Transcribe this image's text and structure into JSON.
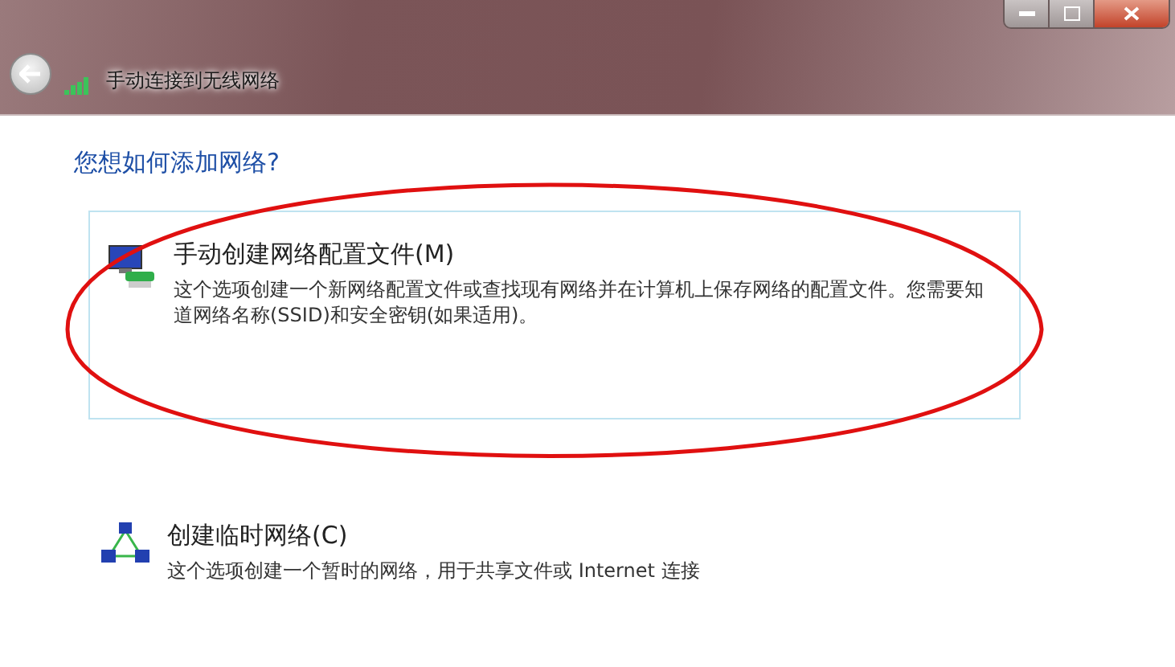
{
  "window": {
    "title": "手动连接到无线网络"
  },
  "heading": "您想如何添加网络?",
  "options": [
    {
      "kind": "manual",
      "title": "手动创建网络配置文件(M)",
      "description": "这个选项创建一个新网络配置文件或查找现有网络并在计算机上保存网络的配置文件。您需要知道网络名称(SSID)和安全密钥(如果适用)。",
      "selected": true
    },
    {
      "kind": "adhoc",
      "title": "创建临时网络(C)",
      "description": "这个选项创建一个暂时的网络，用于共享文件或 Internet 连接",
      "selected": false
    }
  ]
}
